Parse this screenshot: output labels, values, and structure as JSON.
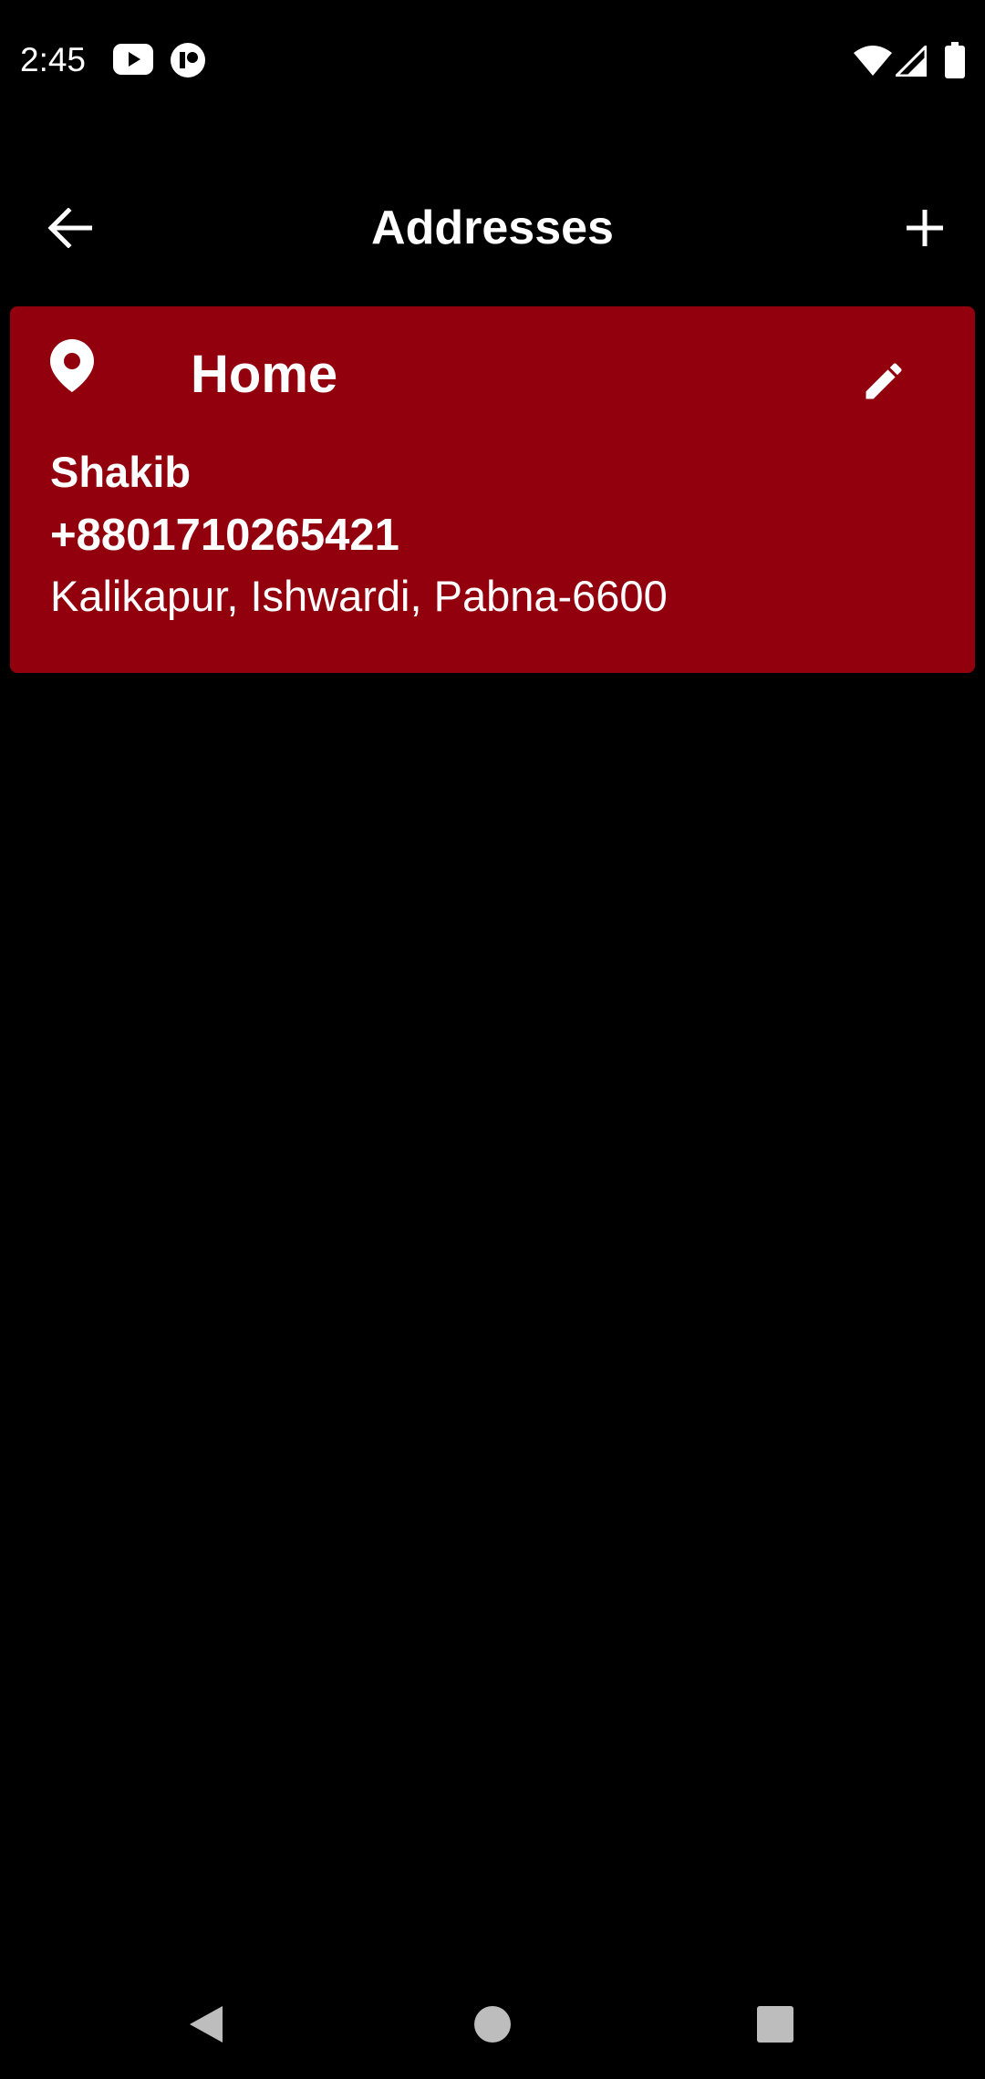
{
  "status_bar": {
    "time": "2:45",
    "icons": [
      "youtube-icon",
      "app-notification-icon",
      "wifi-icon",
      "signal-icon",
      "battery-icon"
    ]
  },
  "app_bar": {
    "title": "Addresses",
    "back_icon": "arrow-back-icon",
    "add_icon": "plus-icon"
  },
  "addresses": [
    {
      "label": "Home",
      "name": "Shakib",
      "phone": "+8801710265421",
      "address": "Kalikapur, Ishwardi, Pabna-6600",
      "icon": "location-pin-icon",
      "edit_icon": "pencil-icon"
    }
  ],
  "nav_bar": {
    "back": "triangle-back-icon",
    "home": "circle-home-icon",
    "recents": "square-recents-icon"
  },
  "colors": {
    "background": "#000000",
    "card": "#92000d",
    "text": "#ffffff"
  }
}
